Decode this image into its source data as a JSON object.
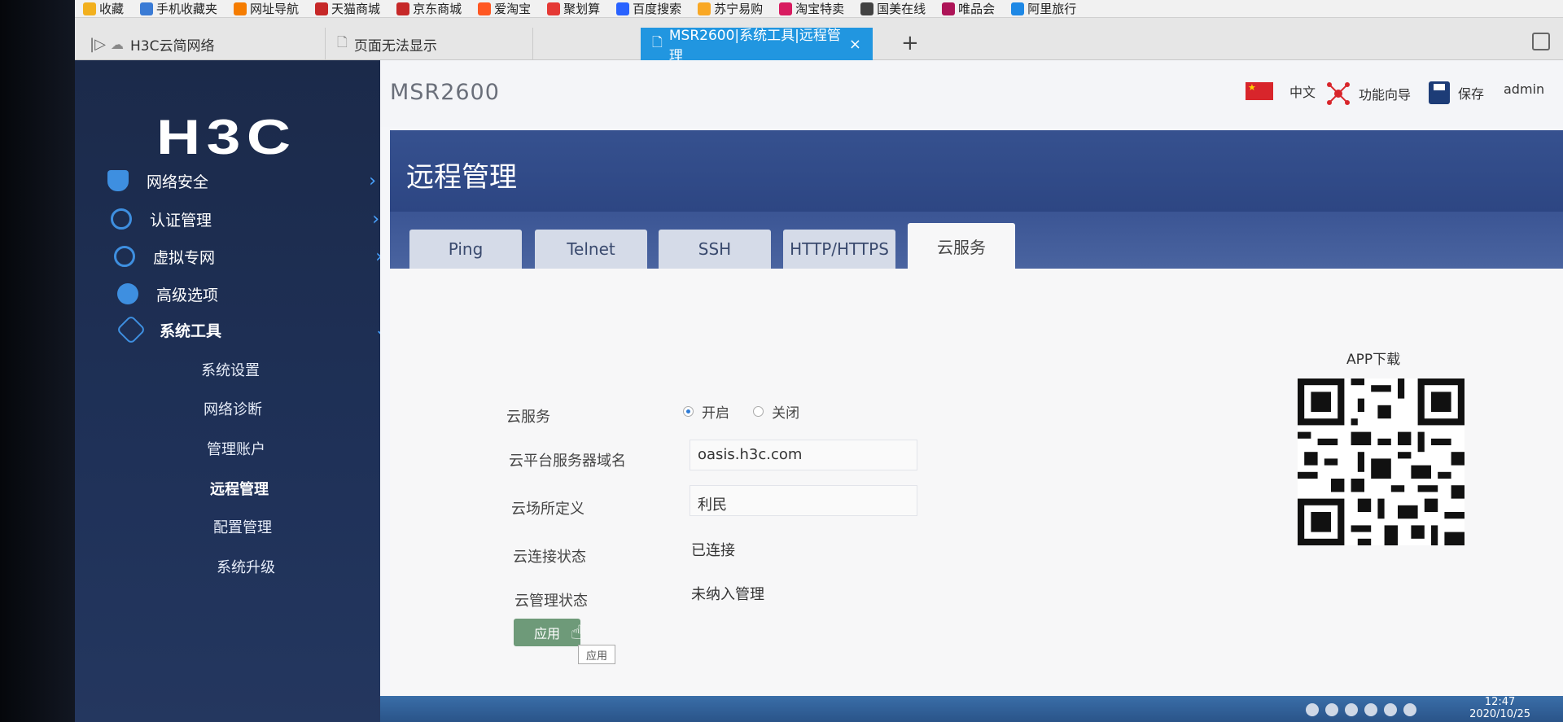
{
  "bookmarks": [
    {
      "label": "收藏",
      "icon": "star-icon",
      "color": "#f2b01e"
    },
    {
      "label": "手机收藏夹",
      "icon": "phone-icon",
      "color": "#3a7bd5"
    },
    {
      "label": "网址导航",
      "icon": "nav-icon",
      "color": "#f57c00"
    },
    {
      "label": "天猫商城",
      "icon": "tmall-icon",
      "color": "#c62828"
    },
    {
      "label": "京东商城",
      "icon": "jd-icon",
      "color": "#c62828"
    },
    {
      "label": "爱淘宝",
      "icon": "taobao-icon",
      "color": "#ff5722"
    },
    {
      "label": "聚划算",
      "icon": "juhuasuan-icon",
      "color": "#e53935"
    },
    {
      "label": "百度搜索",
      "icon": "baidu-icon",
      "color": "#2962ff"
    },
    {
      "label": "苏宁易购",
      "icon": "suning-icon",
      "color": "#f9a825"
    },
    {
      "label": "淘宝特卖",
      "icon": "taobao-sale-icon",
      "color": "#d81b60"
    },
    {
      "label": "国美在线",
      "icon": "gome-icon",
      "color": "#424242"
    },
    {
      "label": "唯品会",
      "icon": "vip-icon",
      "color": "#ad1457"
    },
    {
      "label": "阿里旅行",
      "icon": "alitrip-icon",
      "color": "#1e88e5"
    }
  ],
  "tabs": [
    {
      "title": "H3C云简网络",
      "icon": "cloud-icon"
    },
    {
      "title": "页面无法显示",
      "icon": "page-icon"
    },
    {
      "title": "MSR2600|系统工具|远程管理",
      "icon": "page-icon",
      "close": "×"
    }
  ],
  "new_tab": "+",
  "brand": {
    "logo": "H3C"
  },
  "nav": [
    {
      "label": "网络安全",
      "icon": "shield-icon",
      "chevron": "›"
    },
    {
      "label": "认证管理",
      "icon": "globe-icon",
      "chevron": "›"
    },
    {
      "label": "虚拟专网",
      "icon": "vpn-globe-icon",
      "chevron": "›"
    },
    {
      "label": "高级选项",
      "icon": "advanced-icon",
      "chevron": "›"
    },
    {
      "label": "系统工具",
      "icon": "tools-icon",
      "chevron": "⌄"
    }
  ],
  "subnav": [
    "系统设置",
    "网络诊断",
    "管理账户",
    "远程管理",
    "配置管理",
    "系统升级"
  ],
  "topbar": {
    "device": "MSR2600",
    "language": "中文",
    "wizard": "功能向导",
    "save": "保存",
    "user": "admin"
  },
  "panel": {
    "title": "远程管理",
    "tabs": [
      "Ping",
      "Telnet",
      "SSH",
      "HTTP/HTTPS",
      "云服务"
    ],
    "active_tab": "云服务"
  },
  "form": {
    "cloud_service_label": "云服务",
    "radio_on": "开启",
    "radio_off": "关闭",
    "server_domain_label": "云平台服务器域名",
    "server_domain_value": "oasis.h3c.com",
    "site_label": "云场所定义",
    "site_value": "利民",
    "conn_label": "云连接状态",
    "conn_value": "已连接",
    "mgmt_label": "云管理状态",
    "mgmt_value": "未纳入管理",
    "apply": "应用",
    "tooltip": "应用"
  },
  "app_download": "APP下载",
  "taskbar": {
    "time": "12:47",
    "date": "2020/10/25"
  },
  "colors": {
    "sidebar": "#1f3158",
    "header": "#2d4683",
    "accent": "#2196e0",
    "apply": "#6e9a79"
  }
}
